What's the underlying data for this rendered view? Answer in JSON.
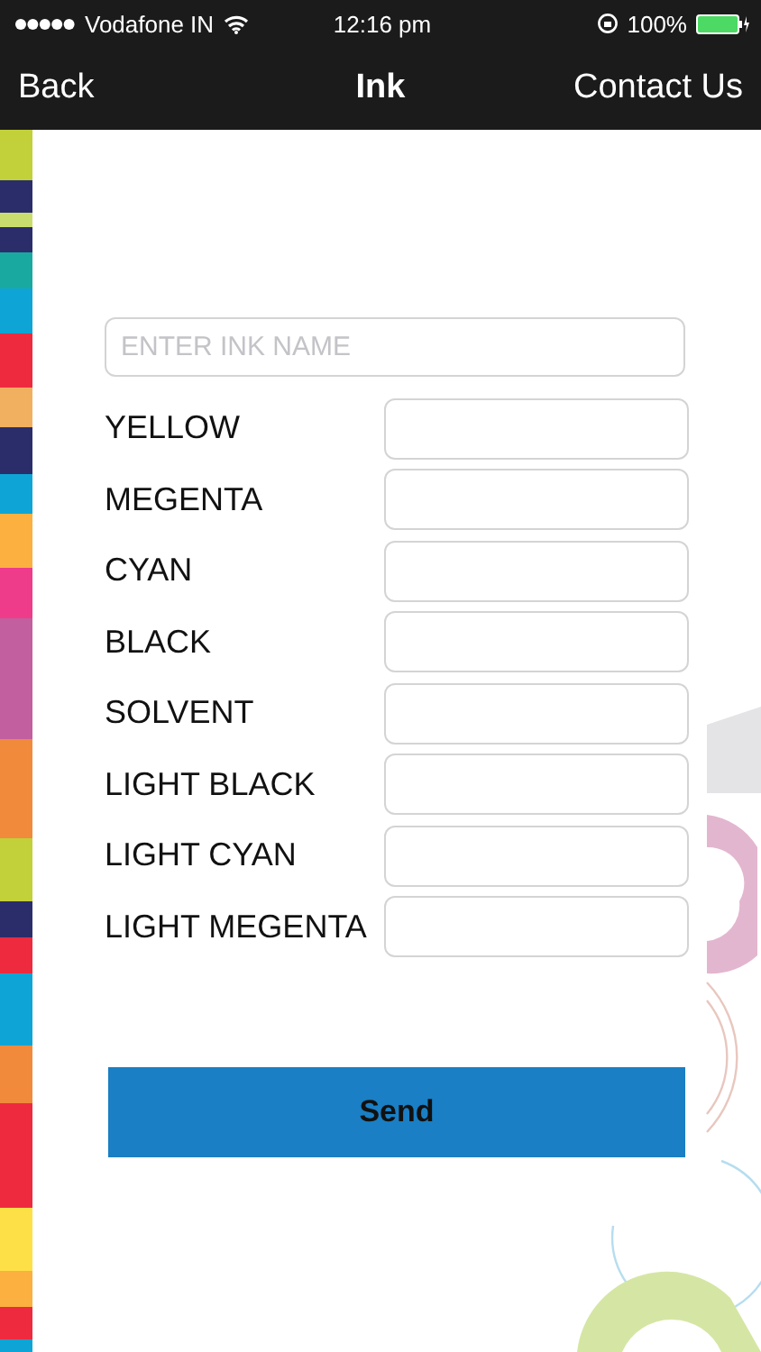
{
  "status_bar": {
    "carrier": "Vodafone IN",
    "time": "12:16 pm",
    "battery": "100%"
  },
  "nav": {
    "back": "Back",
    "title": "Ink",
    "action": "Contact Us"
  },
  "name_field": {
    "placeholder": "ENTER INK NAME"
  },
  "fields": [
    {
      "label": "YELLOW"
    },
    {
      "label": "MEGENTA"
    },
    {
      "label": "CYAN"
    },
    {
      "label": "BLACK"
    },
    {
      "label": "SOLVENT"
    },
    {
      "label": "LIGHT BLACK"
    },
    {
      "label": "LIGHT CYAN"
    },
    {
      "label": "LIGHT MEGENTA"
    }
  ],
  "button": "Send"
}
